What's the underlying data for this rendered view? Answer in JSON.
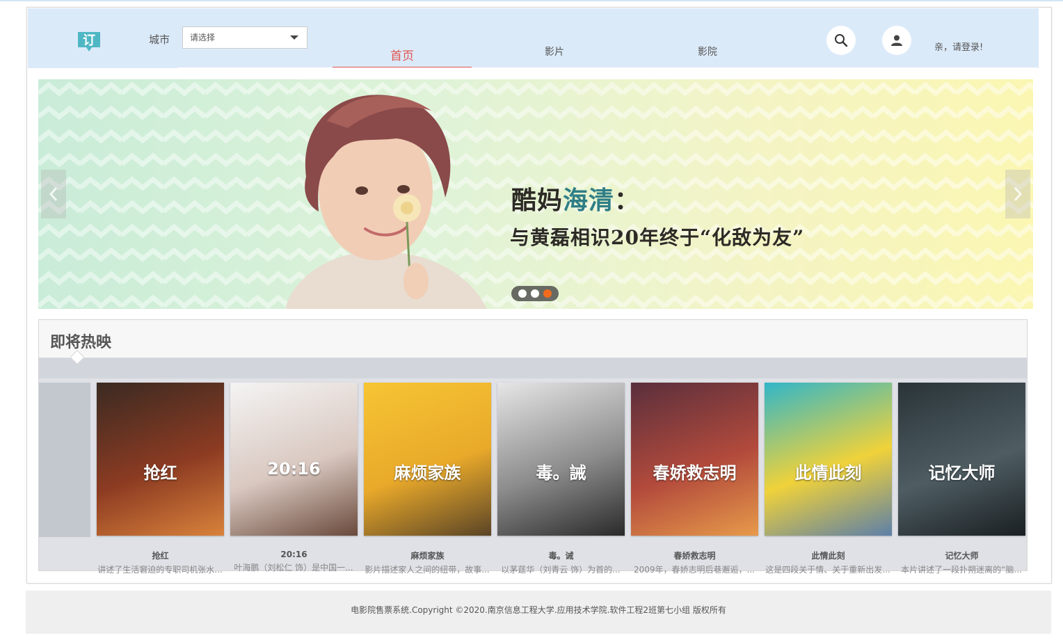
{
  "header": {
    "city_label": "城市",
    "city_select_value": "请选择",
    "nav": [
      {
        "label": "首页",
        "active": true
      },
      {
        "label": "影片",
        "active": false
      },
      {
        "label": "影院",
        "active": false
      }
    ],
    "login_text": "亲，请登录!",
    "icons": {
      "logo": "ticket-logo-icon",
      "search": "search-icon",
      "user": "user-icon"
    }
  },
  "carousel": {
    "title_part1": "酷妈",
    "title_accent": "海清",
    "title_part2": "：",
    "subtitle": "与黄磊相识20年终于“化敌为友”",
    "slide_count": 3,
    "active_slide": 3
  },
  "upcoming": {
    "title": "即将热映",
    "movies": [
      {
        "name": "抢红",
        "desc": "讲述了生活窘迫的专职司机张水...",
        "poster_text": "抢红",
        "colors": [
          "#3a2a22",
          "#8c3b22",
          "#d9823b"
        ]
      },
      {
        "name": "20:16",
        "desc": "叶海鹏（刘松仁 饰）是中国一...",
        "poster_text": "20:16",
        "colors": [
          "#f4f4f4",
          "#d9c8c0",
          "#6a4a3c"
        ]
      },
      {
        "name": "麻烦家族",
        "desc": "影片描述家人之间的纽带，故事...",
        "poster_text": "麻烦家族",
        "colors": [
          "#f6c534",
          "#e9a92a",
          "#5a4426"
        ]
      },
      {
        "name": "毒。诫",
        "desc": "以茅莛华（刘青云 饰）为首的...",
        "poster_text": "毒。誡",
        "colors": [
          "#e6e6e6",
          "#8c8c8c",
          "#2a2a2a"
        ]
      },
      {
        "name": "春娇救志明",
        "desc": "2009年，春娇志明后巷邂逅，...",
        "poster_text": "春娇救志明",
        "colors": [
          "#5a2f3c",
          "#b24a3c",
          "#e79a4a"
        ]
      },
      {
        "name": "此情此刻",
        "desc": "这是四段关于情、关于重新出发...",
        "poster_text": "此情此刻",
        "colors": [
          "#31b6c8",
          "#f0d23a",
          "#5c7fa8"
        ]
      },
      {
        "name": "记忆大师",
        "desc": "本片讲述了一段扑朔迷离的“脑...",
        "poster_text": "记忆大师",
        "colors": [
          "#2a3438",
          "#4e5d62",
          "#1a1f22"
        ]
      }
    ]
  },
  "footer": {
    "text": "电影院售票系统.Copyright ©2020.南京信息工程大学.应用技术学院.软件工程2班第七小组 版权所有"
  },
  "colors": {
    "header_bg": "#dbeaf9",
    "nav_active": "#e0544f",
    "dot_active": "#f26b1d",
    "logo": "#4fb7c4"
  }
}
